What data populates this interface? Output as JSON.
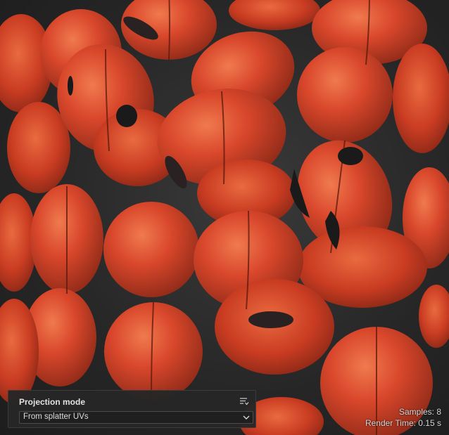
{
  "projection_panel": {
    "title": "Projection mode",
    "menu_icon": "list-options-icon",
    "dropdown": {
      "selected": "From splatter UVs",
      "icon": "chevron-down-icon"
    }
  },
  "render_stats": {
    "samples": "Samples: 8",
    "render_time": "Render Time: 0.15 s"
  },
  "viewport": {
    "subject": "ladybug-beetles",
    "colors": {
      "shell": "#d9472b",
      "shell_dark": "#a8321d",
      "shell_highlight": "#f07a4e",
      "spot": "#1a1a1a",
      "background": "#2b2b2b"
    }
  }
}
